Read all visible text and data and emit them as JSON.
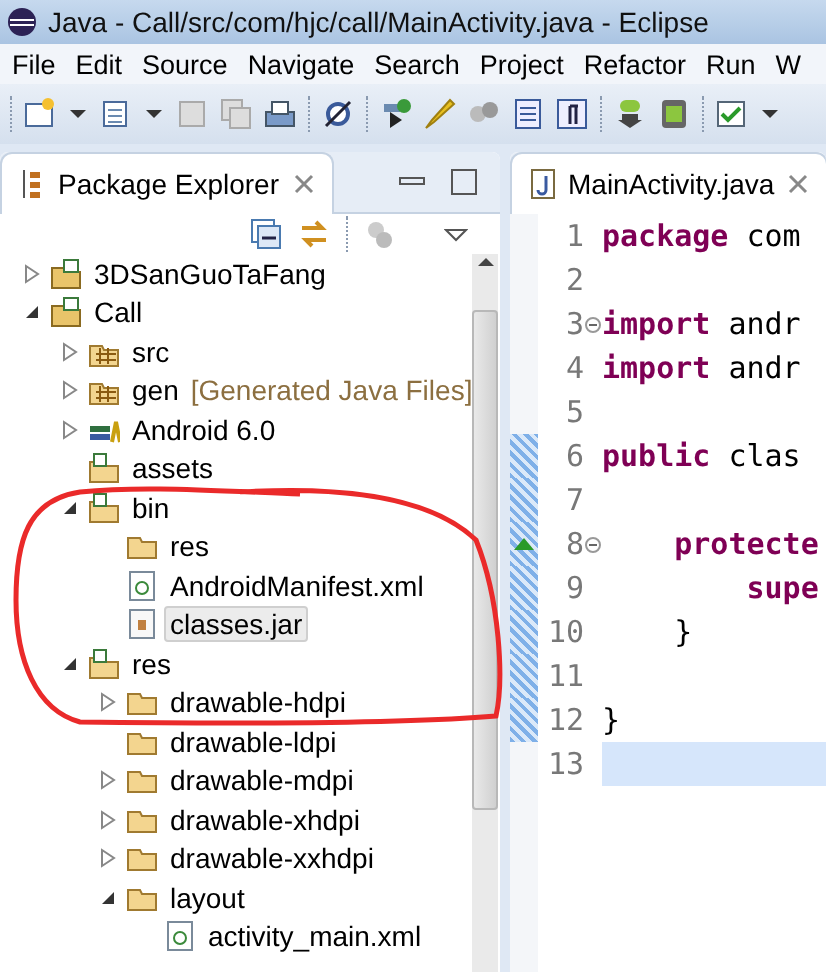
{
  "window": {
    "title": "Java - Call/src/com/hjc/call/MainActivity.java - Eclipse"
  },
  "menu": [
    "File",
    "Edit",
    "Source",
    "Navigate",
    "Search",
    "Project",
    "Refactor",
    "Run",
    "W"
  ],
  "explorer": {
    "title": "Package Explorer",
    "tree": [
      {
        "label": "3DSanGuoTaFang",
        "kind": "project",
        "expandable": true,
        "expanded": false,
        "selected": false
      },
      {
        "label": "Call",
        "kind": "project",
        "expandable": true,
        "expanded": true,
        "selected": false,
        "children": [
          {
            "label": "src",
            "kind": "package-folder",
            "expandable": true,
            "expanded": false,
            "selected": false
          },
          {
            "label": "gen",
            "decoration": "[Generated Java Files]",
            "kind": "package-folder",
            "expandable": true,
            "expanded": false,
            "selected": false
          },
          {
            "label": "Android 6.0",
            "kind": "library",
            "expandable": true,
            "expanded": false,
            "selected": false
          },
          {
            "label": "assets",
            "kind": "project-folder",
            "expandable": false,
            "selected": false
          },
          {
            "label": "bin",
            "kind": "project-folder",
            "expandable": true,
            "expanded": true,
            "selected": false,
            "children": [
              {
                "label": "res",
                "kind": "folder",
                "expandable": false,
                "selected": false
              },
              {
                "label": "AndroidManifest.xml",
                "kind": "xml",
                "expandable": false,
                "selected": false
              },
              {
                "label": "classes.jar",
                "kind": "jar",
                "expandable": false,
                "selected": true
              }
            ]
          },
          {
            "label": "res",
            "kind": "project-folder",
            "expandable": true,
            "expanded": true,
            "selected": false,
            "children": [
              {
                "label": "drawable-hdpi",
                "kind": "folder",
                "expandable": true,
                "expanded": false,
                "selected": false
              },
              {
                "label": "drawable-ldpi",
                "kind": "folder",
                "expandable": false,
                "selected": false
              },
              {
                "label": "drawable-mdpi",
                "kind": "folder",
                "expandable": true,
                "expanded": false,
                "selected": false
              },
              {
                "label": "drawable-xhdpi",
                "kind": "folder",
                "expandable": true,
                "expanded": false,
                "selected": false
              },
              {
                "label": "drawable-xxhdpi",
                "kind": "folder",
                "expandable": true,
                "expanded": false,
                "selected": false
              },
              {
                "label": "layout",
                "kind": "folder",
                "expandable": true,
                "expanded": true,
                "selected": false,
                "children": [
                  {
                    "label": "activity_main.xml",
                    "kind": "xml",
                    "expandable": false,
                    "selected": false
                  }
                ]
              }
            ]
          }
        ]
      }
    ]
  },
  "editor": {
    "tab": "MainActivity.java",
    "lines": [
      {
        "number": "1",
        "code": "**package** com",
        "fold": false,
        "override": false,
        "range": false,
        "current": false
      },
      {
        "number": "2",
        "fold": false,
        "override": false,
        "range": false,
        "current": false
      },
      {
        "number": "3",
        "code": "**import** andr",
        "fold": true,
        "override": false,
        "range": false,
        "current": false
      },
      {
        "number": "4",
        "code": "**import** andr",
        "fold": false,
        "override": false,
        "range": false,
        "current": false
      },
      {
        "number": "5",
        "fold": false,
        "override": false,
        "range": false,
        "current": false
      },
      {
        "number": "6",
        "code": "**public** clas",
        "fold": false,
        "override": false,
        "range": true,
        "current": false
      },
      {
        "number": "7",
        "fold": false,
        "override": false,
        "range": true,
        "current": false
      },
      {
        "number": "8",
        "code": "    **protecte**",
        "fold": true,
        "override": true,
        "range": true,
        "current": false
      },
      {
        "number": "9",
        "code": "        **supe**",
        "fold": false,
        "override": false,
        "range": true,
        "current": false
      },
      {
        "number": "10",
        "code": "    }",
        "fold": false,
        "override": false,
        "range": true,
        "current": false
      },
      {
        "number": "11",
        "fold": false,
        "override": false,
        "range": true,
        "current": false
      },
      {
        "number": "12",
        "code": "}",
        "fold": false,
        "override": false,
        "range": true,
        "current": false
      },
      {
        "number": "13",
        "fold": false,
        "override": false,
        "range": false,
        "current": true
      }
    ]
  }
}
